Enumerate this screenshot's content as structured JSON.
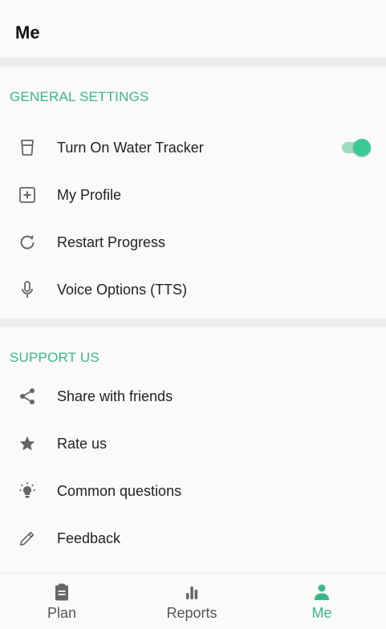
{
  "header": {
    "title": "Me"
  },
  "general": {
    "title": "GENERAL SETTINGS",
    "items": [
      {
        "label": "Turn On Water Tracker",
        "icon": "cup-icon",
        "toggle": true
      },
      {
        "label": "My Profile",
        "icon": "profile-plus-icon"
      },
      {
        "label": "Restart Progress",
        "icon": "restart-icon"
      },
      {
        "label": "Voice Options (TTS)",
        "icon": "microphone-icon"
      }
    ]
  },
  "support": {
    "title": "SUPPORT US",
    "items": [
      {
        "label": "Share with friends",
        "icon": "share-icon"
      },
      {
        "label": "Rate us",
        "icon": "star-icon"
      },
      {
        "label": "Common questions",
        "icon": "lightbulb-icon"
      },
      {
        "label": "Feedback",
        "icon": "pencil-icon"
      }
    ]
  },
  "nav": {
    "items": [
      {
        "label": "Plan",
        "icon": "clipboard-icon"
      },
      {
        "label": "Reports",
        "icon": "bar-chart-icon"
      },
      {
        "label": "Me",
        "icon": "person-icon",
        "active": true
      }
    ]
  },
  "colors": {
    "accent": "#3ab884",
    "toggle_on": "#3dc995"
  }
}
